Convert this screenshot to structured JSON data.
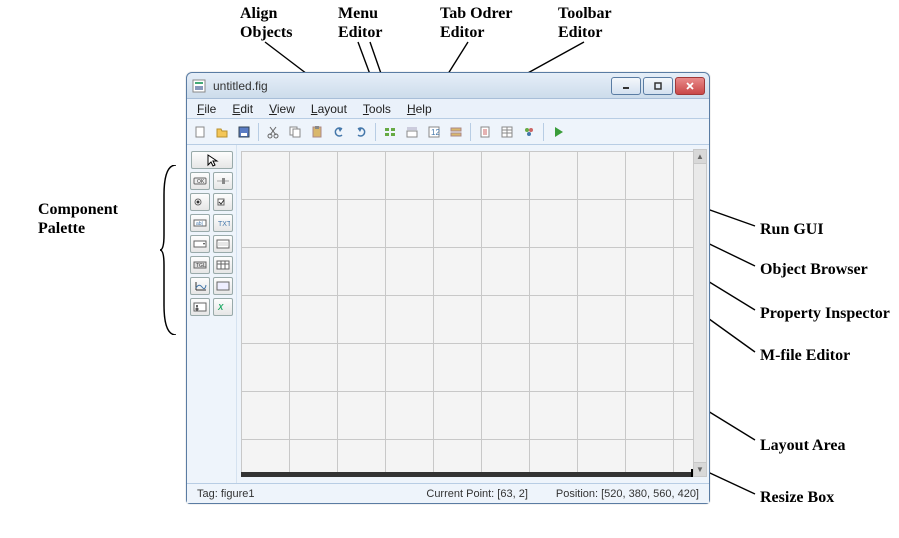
{
  "callouts": {
    "align_objects": "Align\nObjects",
    "menu_editor": "Menu\nEditor",
    "tab_order_editor": "Tab Odrer\nEditor",
    "toolbar_editor": "Toolbar\nEditor",
    "component_palette": "Component\nPalette",
    "run_gui": "Run GUI",
    "object_browser": "Object Browser",
    "property_inspector": "Property Inspector",
    "mfile_editor": "M-file Editor",
    "layout_area": "Layout Area",
    "resize_box": "Resize Box"
  },
  "window": {
    "title": "untitled.fig"
  },
  "menubar": {
    "items": [
      "File",
      "Edit",
      "View",
      "Layout",
      "Tools",
      "Help"
    ]
  },
  "toolbar": {
    "groups": [
      [
        "new-blank-icon",
        "open-icon",
        "save-icon"
      ],
      [
        "cut-icon",
        "copy-icon",
        "paste-icon",
        "undo-icon",
        "redo-icon"
      ],
      [
        "align-objects-icon",
        "menu-editor-icon",
        "tab-order-editor-icon",
        "toolbar-editor-icon"
      ],
      [
        "mfile-editor-icon",
        "property-inspector-icon",
        "object-browser-icon"
      ],
      [
        "run-icon"
      ]
    ]
  },
  "palette": {
    "select_tool": "select-tool",
    "rows": [
      [
        "push-button-icon",
        "slider-icon"
      ],
      [
        "radio-button-icon",
        "checkbox-icon"
      ],
      [
        "edit-text-icon",
        "static-text-icon"
      ],
      [
        "popup-menu-icon",
        "listbox-icon"
      ],
      [
        "toggle-button-icon",
        "table-icon"
      ],
      [
        "axes-icon",
        "panel-icon"
      ],
      [
        "button-group-icon",
        "activex-icon"
      ]
    ]
  },
  "statusbar": {
    "tag_label": "Tag: ",
    "tag_value": "figure1",
    "current_point_label": "Current Point: ",
    "current_point_value": "[63, 2]",
    "position_label": "Position: ",
    "position_value": "[520, 380, 560, 420]"
  }
}
